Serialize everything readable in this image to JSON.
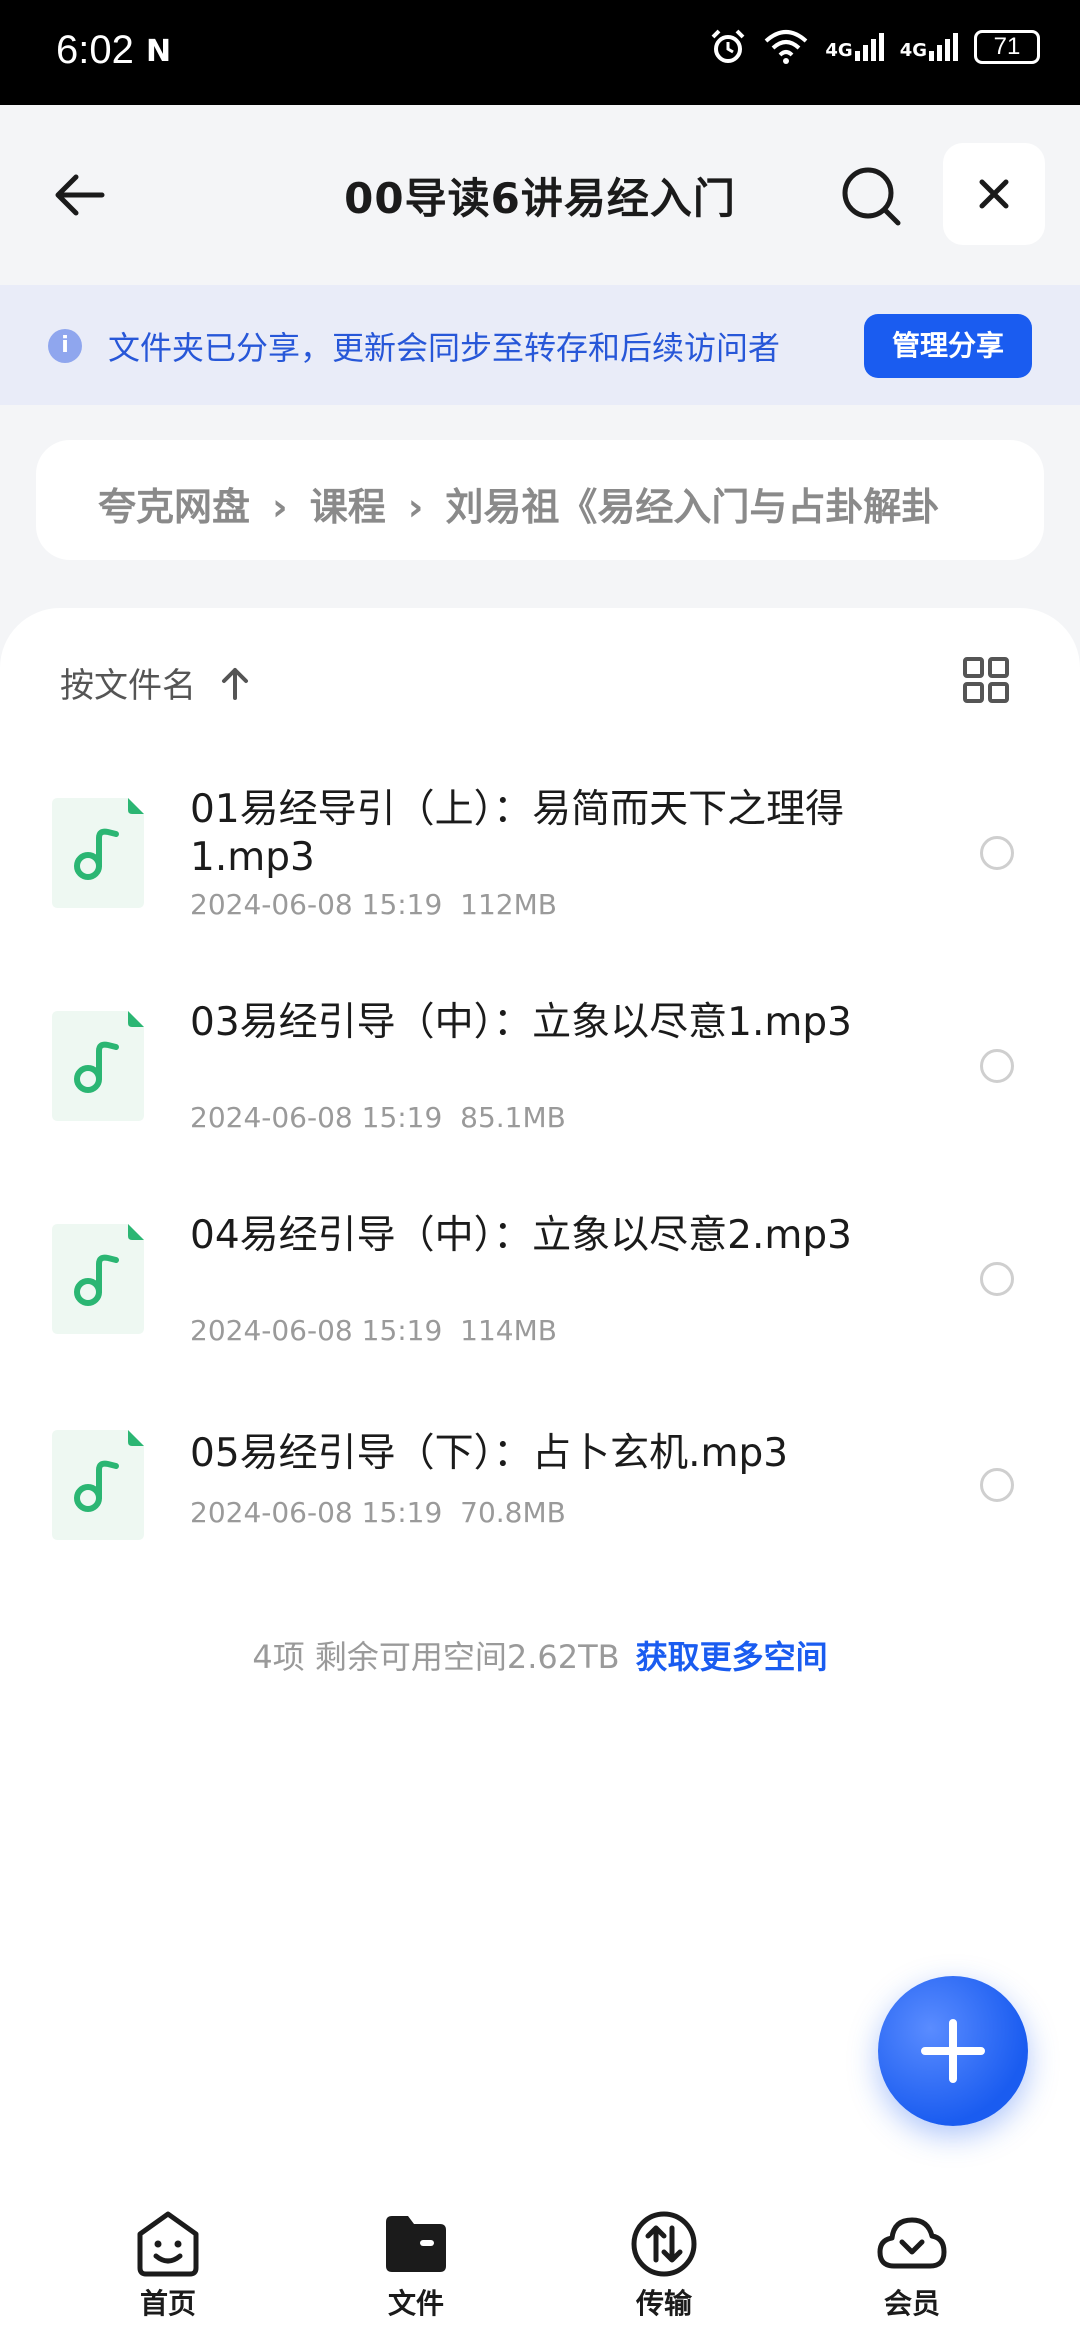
{
  "status_bar": {
    "time": "6:02",
    "battery": "71",
    "network_1": "4G",
    "network_2": "4G"
  },
  "header": {
    "title": "00导读6讲易经入门"
  },
  "share_notice": {
    "text": "文件夹已分享，更新会同步至转存和后续访问者",
    "button": "管理分享"
  },
  "breadcrumb": {
    "items": [
      "夸克网盘",
      "课程",
      "刘易祖《易经入门与占卦解卦"
    ]
  },
  "sort": {
    "label": "按文件名"
  },
  "files": [
    {
      "name": "01易经导引（上）：易简而天下之理得1.mp3",
      "date": "2024-06-08 15:19",
      "size": "112MB"
    },
    {
      "name": "03易经引导（中）：立象以尽意1.mp3",
      "date": "2024-06-08 15:19",
      "size": "85.1MB"
    },
    {
      "name": "04易经引导（中）：立象以尽意2.mp3",
      "date": "2024-06-08 15:19",
      "size": "114MB"
    },
    {
      "name": "05易经引导（下）：占卜玄机.mp3",
      "date": "2024-06-08 15:19",
      "size": "70.8MB"
    }
  ],
  "footer": {
    "count_space": "4项 剩余可用空间2.62TB",
    "link": "获取更多空间"
  },
  "bottom_nav": [
    {
      "label": "首页",
      "icon": "home-face-icon"
    },
    {
      "label": "文件",
      "icon": "folder-icon"
    },
    {
      "label": "传输",
      "icon": "transfer-icon"
    },
    {
      "label": "会员",
      "icon": "cloud-icon"
    }
  ],
  "colors": {
    "accent": "#1a5cf0",
    "notice_bg": "#e9ecf8",
    "audio_green": "#2bb673"
  }
}
